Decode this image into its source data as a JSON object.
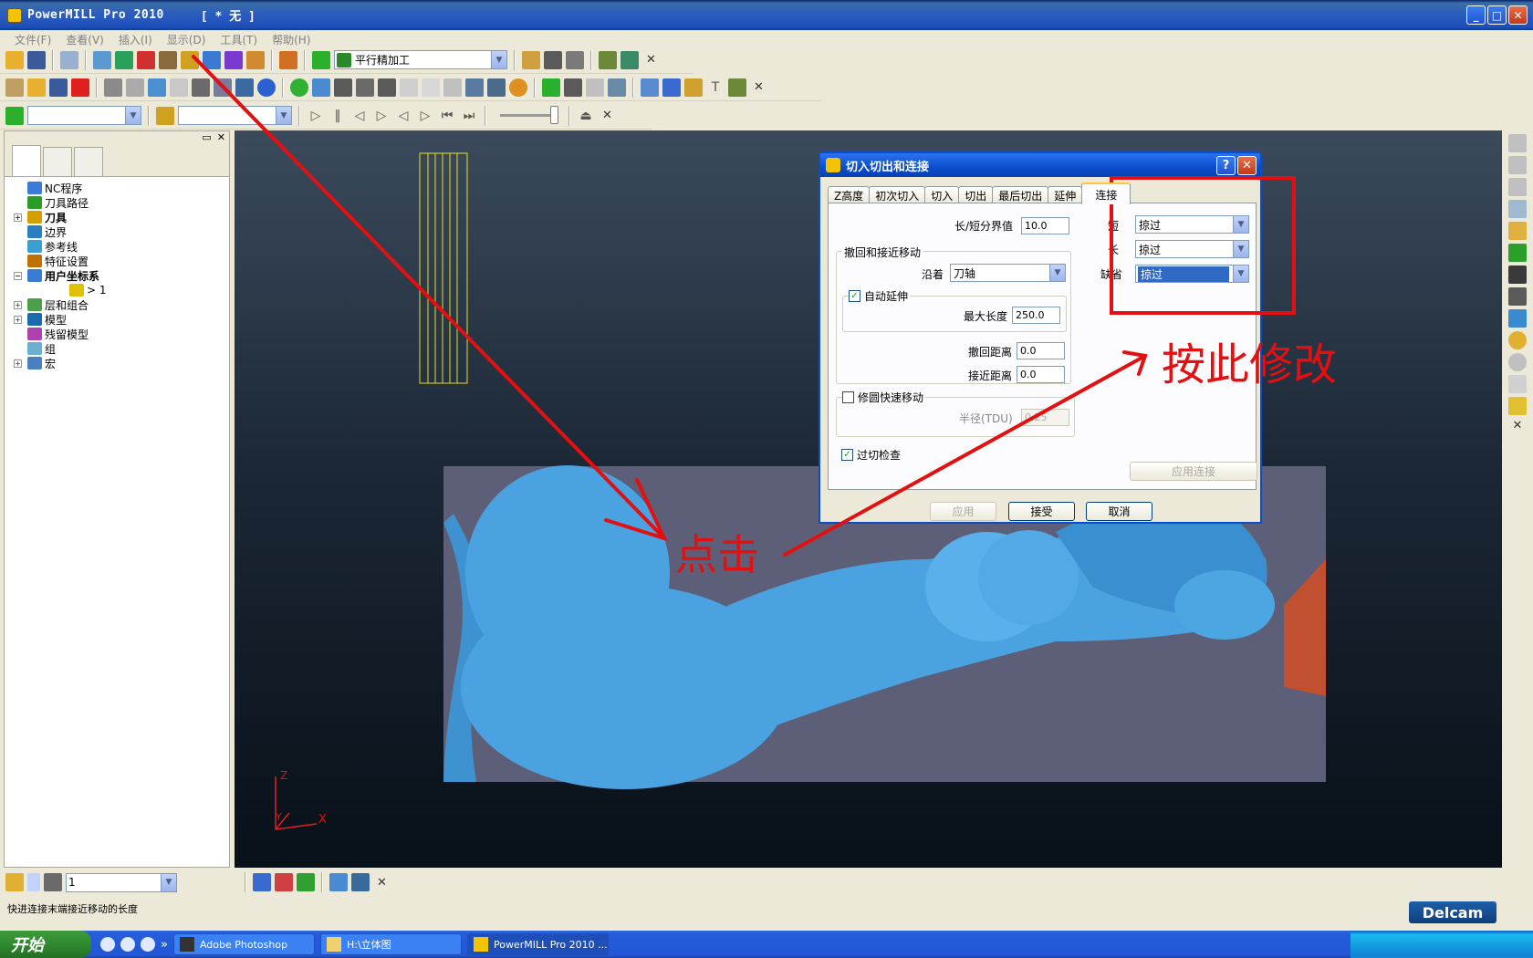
{
  "window": {
    "title": "PowerMILL Pro 2010",
    "doc": "[ * 无 ]",
    "min": "_",
    "max": "□",
    "close": "✕"
  },
  "menu": [
    "文件(F)",
    "查看(V)",
    "插入(I)",
    "显示(D)",
    "工具(T)",
    "帮助(H)"
  ],
  "toolbar1": {
    "strategy_value": "平行精加工"
  },
  "toolbar3": {
    "combo1_value": "",
    "combo2_value": ""
  },
  "explorer": {
    "items": [
      {
        "label": "NC程序",
        "expand": false,
        "bold": false,
        "color": "#3a7bd5"
      },
      {
        "label": "刀具路径",
        "expand": false,
        "bold": false,
        "color": "#2a9c2a"
      },
      {
        "label": "刀具",
        "expand": true,
        "bold": true,
        "color": "#d4a000"
      },
      {
        "label": "边界",
        "expand": false,
        "bold": false,
        "color": "#2a7fc0"
      },
      {
        "label": "参考线",
        "expand": false,
        "bold": false,
        "color": "#3a9fd0"
      },
      {
        "label": "特征设置",
        "expand": false,
        "bold": false,
        "color": "#c07000"
      },
      {
        "label": "用户坐标系",
        "expand": true,
        "bold": true,
        "color": "#3a7bd5",
        "expanded": true
      },
      {
        "label": "> 1",
        "expand": false,
        "bold": false,
        "color": "#e0c000",
        "indent": true
      },
      {
        "label": "层和组合",
        "expand": true,
        "bold": false,
        "color": "#4aa04a"
      },
      {
        "label": "模型",
        "expand": true,
        "bold": false,
        "color": "#1a6ab0"
      },
      {
        "label": "残留模型",
        "expand": false,
        "bold": false,
        "color": "#b040b0"
      },
      {
        "label": "组",
        "expand": false,
        "bold": false,
        "color": "#6ab0d0"
      },
      {
        "label": "宏",
        "expand": true,
        "bold": false,
        "color": "#4a80c0"
      }
    ]
  },
  "dialog": {
    "title": "切入切出和连接",
    "help": "?",
    "close": "✕",
    "tabs": [
      "Z高度",
      "初次切入",
      "切入",
      "切出",
      "最后切出",
      "延伸",
      "连接"
    ],
    "active_tab": "连接",
    "threshold_label": "长/短分界值",
    "threshold_value": "10.0",
    "retract_group": "撤回和接近移动",
    "along_label": "沿着",
    "along_value": "刀轴",
    "auto_extend_label": "自动延伸",
    "auto_extend_checked": true,
    "max_length_label": "最大长度",
    "max_length_value": "250.0",
    "retract_dist_label": "撤回距离",
    "retract_dist_value": "0.0",
    "approach_dist_label": "接近距离",
    "approach_dist_value": "0.0",
    "arc_rapid_label": "修圆快速移动",
    "arc_rapid_checked": false,
    "radius_label": "半径(TDU)",
    "radius_value": "0.25",
    "gouge_label": "过切检查",
    "gouge_checked": true,
    "short_label": "短",
    "short_value": "掠过",
    "long_label": "长",
    "long_value": "掠过",
    "default_label": "缺省",
    "default_value": "掠过",
    "apply_link_label": "应用连接",
    "apply_label": "应用",
    "accept_label": "接受",
    "cancel_label": "取消"
  },
  "annotations": {
    "click": "点击",
    "modify_here": "按此修改",
    "color": "#e21010"
  },
  "axes": {
    "z": "Z",
    "y": "Y",
    "x": "X"
  },
  "bottombar": {
    "combo_value": "1"
  },
  "status": "快进连接末端接近移动的长度",
  "brand": "Delcam",
  "taskbar": {
    "start": "开始",
    "tasks": [
      "Adobe Photoshop",
      "H:\\立体图",
      "PowerMILL Pro 2010 ..."
    ],
    "active_task": 2
  }
}
